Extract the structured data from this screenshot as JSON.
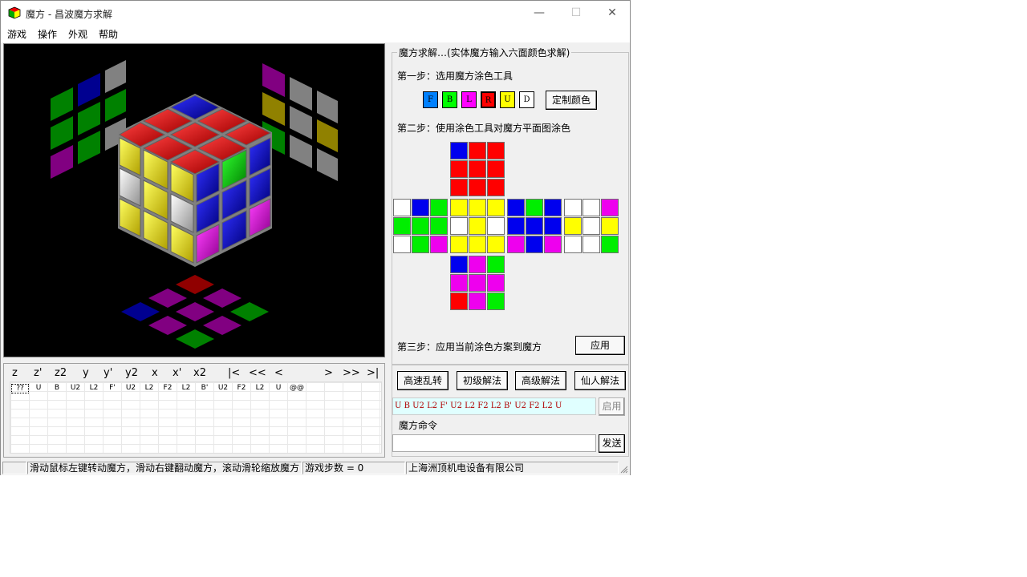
{
  "window": {
    "title": "魔方 - 昌波魔方求解",
    "minimize": "—",
    "maximize": "☐",
    "close": "✕"
  },
  "menu": [
    "游戏",
    "操作",
    "外观",
    "帮助"
  ],
  "moves": {
    "buttons": [
      "z",
      "z'",
      "z2",
      "y",
      "y'",
      "y2",
      "x",
      "x'",
      "x2",
      "|<",
      "<<",
      "<",
      ">",
      ">>",
      ">|"
    ],
    "history": [
      "??",
      "U",
      "B",
      "U2",
      "L2",
      "F'",
      "U2",
      "L2",
      "F2",
      "L2",
      "B'",
      "U2",
      "F2",
      "L2",
      "U",
      "@@"
    ]
  },
  "solver": {
    "group_title": "魔方求解…(实体魔方输入六面颜色求解)",
    "step1": "第一步：选用魔方涂色工具",
    "colors": [
      {
        "label": "F",
        "color": "#0080ff"
      },
      {
        "label": "B",
        "color": "#00ff00"
      },
      {
        "label": "L",
        "color": "#ff00ff"
      },
      {
        "label": "R",
        "color": "#ff0000"
      },
      {
        "label": "U",
        "color": "#ffff00"
      },
      {
        "label": "D",
        "color": "#ffffff"
      }
    ],
    "custom_color": "定制颜色",
    "step2": "第二步：使用涂色工具对魔方平面图涂色",
    "net": {
      "up": [
        [
          "b",
          "r",
          "r"
        ],
        [
          "r",
          "r",
          "r"
        ],
        [
          "r",
          "r",
          "r"
        ]
      ],
      "left": [
        [
          "w",
          "b",
          "g"
        ],
        [
          "g",
          "g",
          "g"
        ],
        [
          "w",
          "g",
          "m"
        ]
      ],
      "front": [
        [
          "y",
          "y",
          "y"
        ],
        [
          "w",
          "y",
          "w"
        ],
        [
          "y",
          "y",
          "y"
        ]
      ],
      "right": [
        [
          "b",
          "g",
          "b"
        ],
        [
          "b",
          "b",
          "b"
        ],
        [
          "m",
          "b",
          "m"
        ]
      ],
      "back": [
        [
          "w",
          "w",
          "m"
        ],
        [
          "y",
          "w",
          "y"
        ],
        [
          "w",
          "w",
          "g"
        ]
      ],
      "down": [
        [
          "b",
          "m",
          "g"
        ],
        [
          "m",
          "m",
          "m"
        ],
        [
          "r",
          "m",
          "g"
        ]
      ]
    },
    "step3": "第三步：应用当前涂色方案到魔方",
    "apply": "应用"
  },
  "actions": [
    "高速乱转",
    "初级解法",
    "高级解法",
    "仙人解法"
  ],
  "sequence": "U B U2 L2 F' U2 L2 F2 L2 B' U2 F2 L2 U",
  "enable": "启用",
  "command": {
    "title": "魔方命令",
    "send": "发送"
  },
  "status": {
    "hint": "滑动鼠标左键转动魔方，滑动右键翻动魔方，滚动滑轮缩放魔方",
    "steps": "游戏步数 = 0",
    "company": "上海洲顶机电设备有限公司"
  },
  "palette": {
    "r": "#ff0000",
    "g": "#00ee00",
    "b": "#0000ee",
    "y": "#ffff00",
    "w": "#ffffff",
    "m": "#ee00ee"
  }
}
